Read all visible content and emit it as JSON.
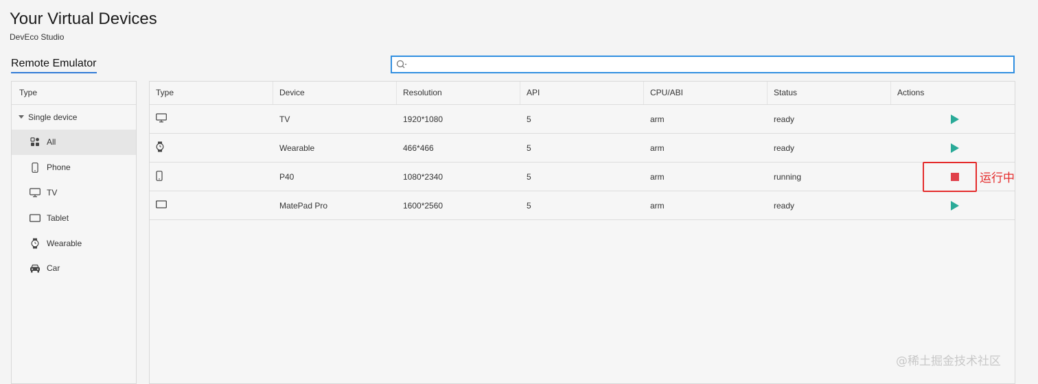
{
  "header": {
    "title": "Your Virtual Devices",
    "subtitle": "DevEco Studio",
    "tab_label": "Remote Emulator"
  },
  "search": {
    "value": "",
    "placeholder": ""
  },
  "sidebar": {
    "header": "Type",
    "group_label": "Single device",
    "items": [
      {
        "label": "All",
        "icon": "grid-icon",
        "active": true
      },
      {
        "label": "Phone",
        "icon": "phone-icon"
      },
      {
        "label": "TV",
        "icon": "tv-icon"
      },
      {
        "label": "Tablet",
        "icon": "tablet-icon"
      },
      {
        "label": "Wearable",
        "icon": "watch-icon"
      },
      {
        "label": "Car",
        "icon": "car-icon"
      }
    ]
  },
  "table": {
    "columns": [
      "Type",
      "Device",
      "Resolution",
      "API",
      "CPU/ABI",
      "Status",
      "Actions"
    ],
    "rows": [
      {
        "type_icon": "tv-icon",
        "device": "TV",
        "resolution": "1920*1080",
        "api": "5",
        "cpu": "arm",
        "status": "ready",
        "action": "play-icon"
      },
      {
        "type_icon": "watch-icon",
        "device": "Wearable",
        "resolution": "466*466",
        "api": "5",
        "cpu": "arm",
        "status": "ready",
        "action": "play-icon"
      },
      {
        "type_icon": "phone-icon",
        "device": "P40",
        "resolution": "1080*2340",
        "api": "5",
        "cpu": "arm",
        "status": "running",
        "action": "stop-icon"
      },
      {
        "type_icon": "tablet-icon",
        "device": "MatePad Pro",
        "resolution": "1600*2560",
        "api": "5",
        "cpu": "arm",
        "status": "ready",
        "action": "play-icon"
      }
    ]
  },
  "annotation": {
    "text": "运行中",
    "color": "#e42a2a"
  },
  "watermark": "@稀土掘金技术社区",
  "colors": {
    "accent": "#2f7ad6",
    "play": "#2aaa98",
    "stop": "#e0404a"
  }
}
